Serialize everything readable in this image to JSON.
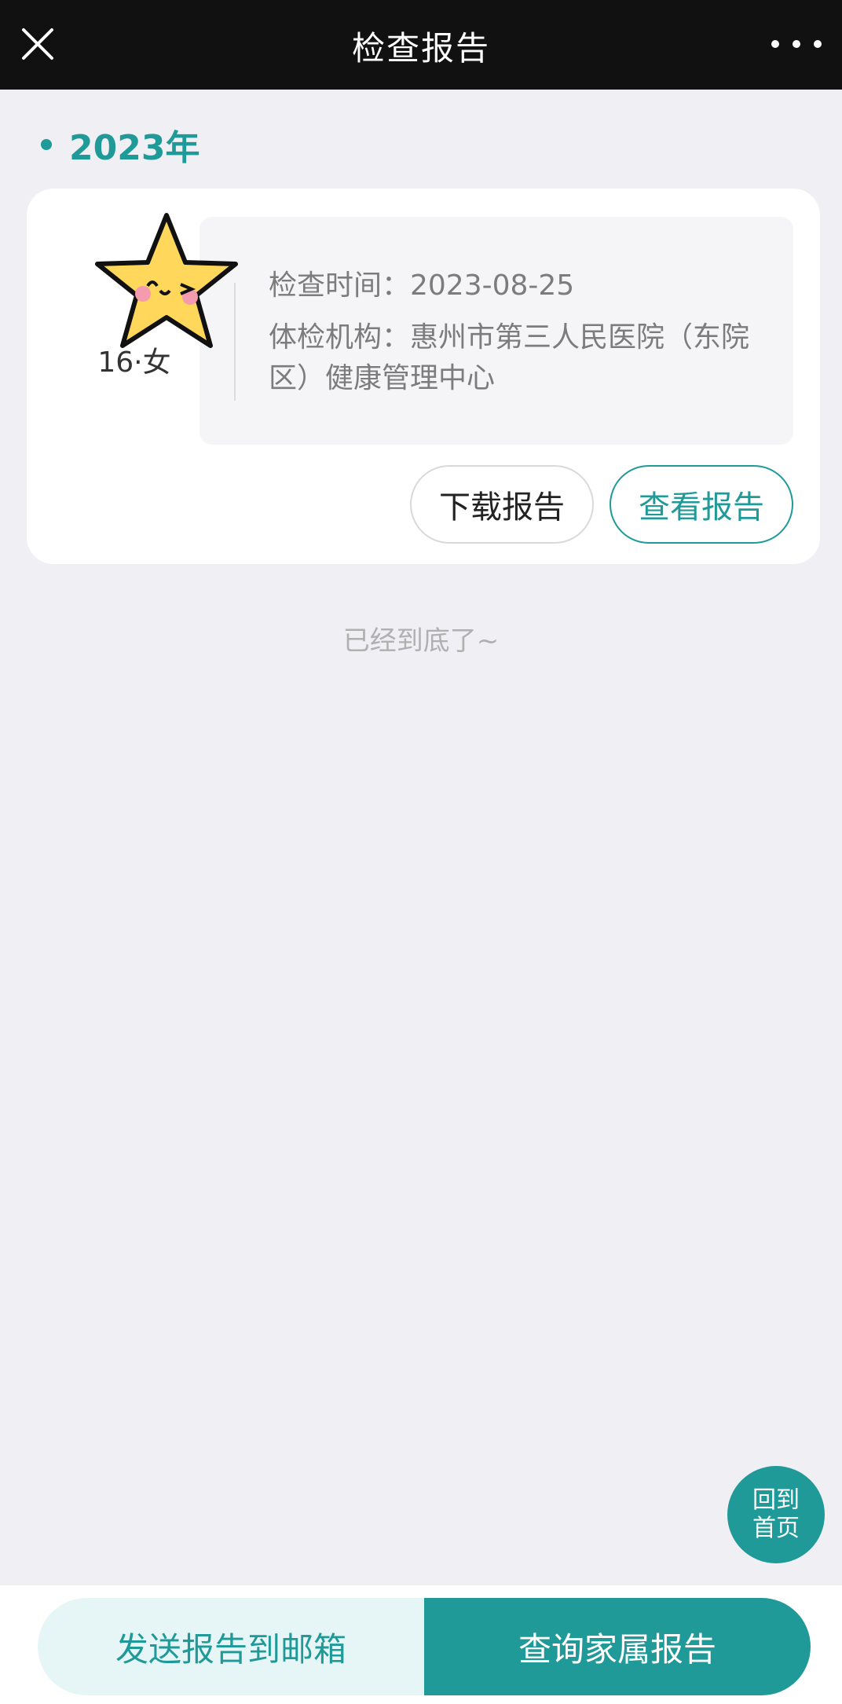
{
  "header": {
    "title": "检查报告",
    "close_icon": "close-icon",
    "more_icon": "more-icon"
  },
  "section": {
    "year": "2023年"
  },
  "report": {
    "avatar_icon": "star-face-icon",
    "age_gender": "16·女",
    "exam_time": "检查时间：2023-08-25",
    "institution": "体检机构：惠州市第三人民医院（东院区）健康管理中心",
    "download_label": "下载报告",
    "view_label": "查看报告"
  },
  "footer_note": "已经到底了~",
  "home_button": {
    "line1": "回到",
    "line2": "首页"
  },
  "bottom_actions": {
    "send_email": "发送报告到邮箱",
    "family_reports": "查询家属报告"
  },
  "colors": {
    "accent": "#1f9a99",
    "topbar": "#111111",
    "background": "#efeff4"
  }
}
